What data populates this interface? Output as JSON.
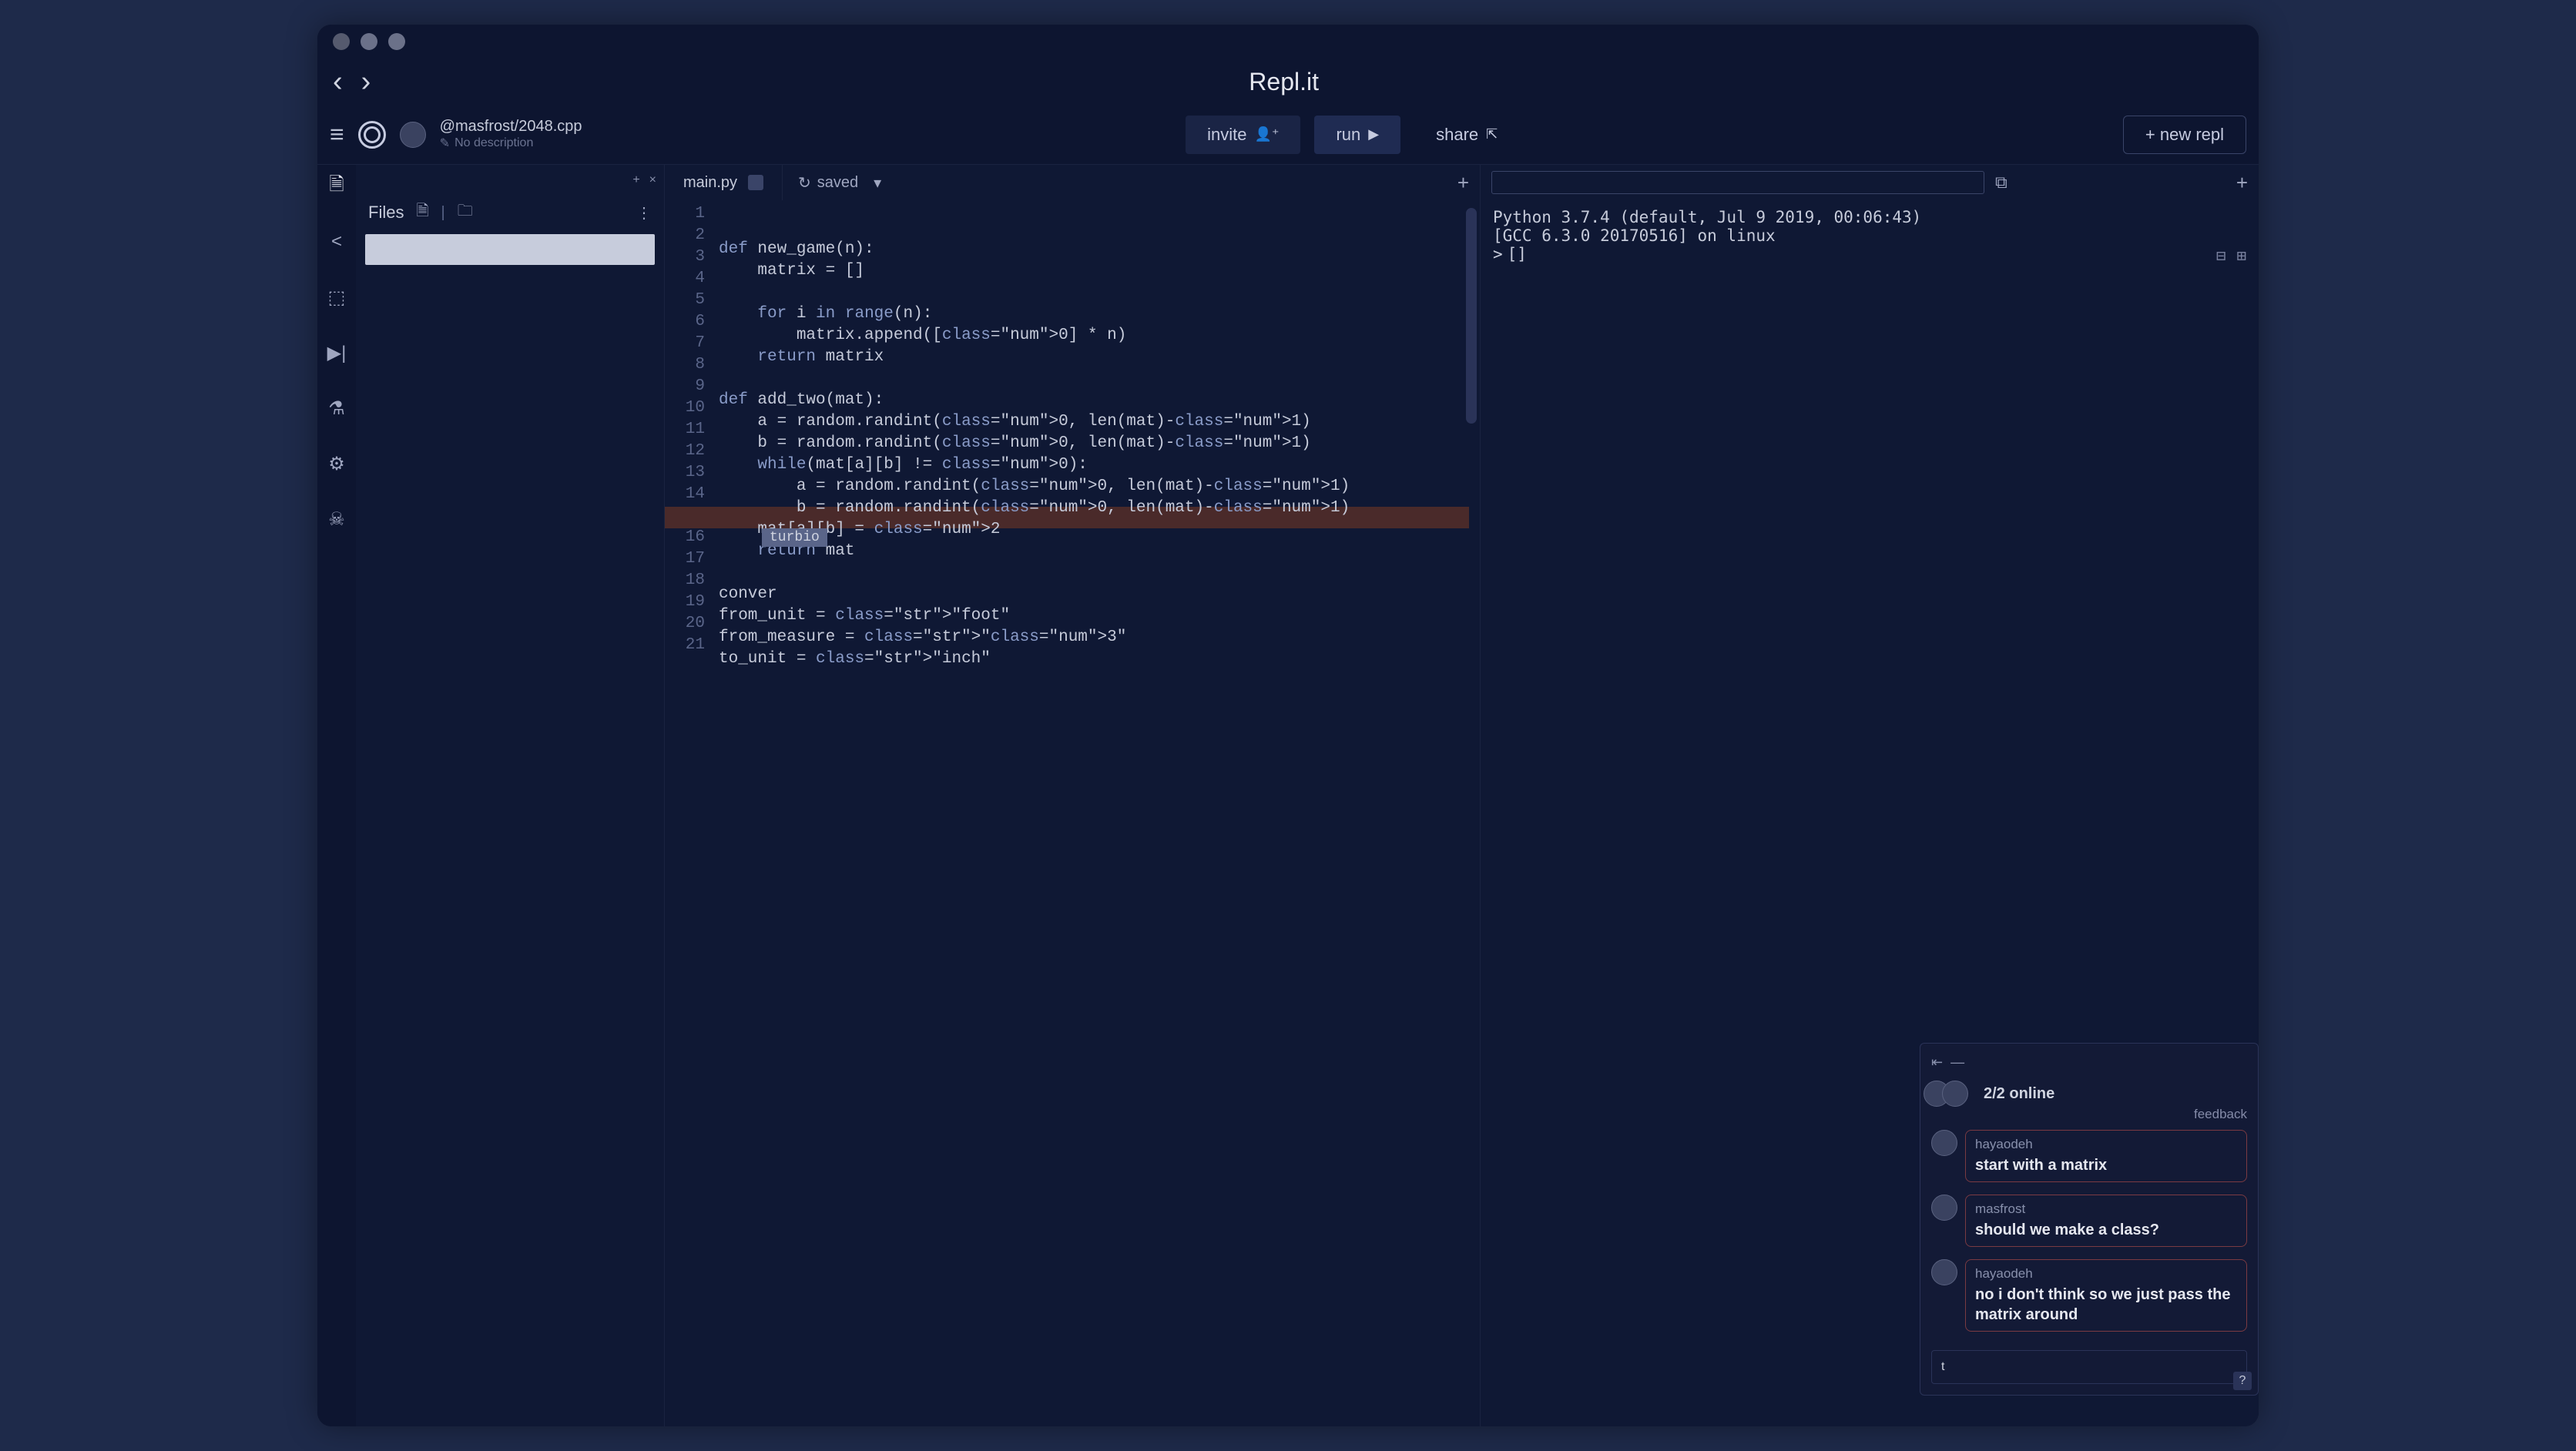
{
  "window": {
    "title": "Repl.it"
  },
  "repl": {
    "owner_path": "@masfrost/2048.cpp",
    "description": "No description"
  },
  "toolbar": {
    "invite": "invite",
    "run": "run",
    "share": "share",
    "new_repl": "+ new repl"
  },
  "files": {
    "header": "Files"
  },
  "editor": {
    "tab_name": "main.py",
    "saved_label": "saved",
    "suggestion": "turbio",
    "lines": [
      "def new_game(n):",
      "    matrix = []",
      "",
      "    for i in range(n):",
      "        matrix.append([0] * n)",
      "    return matrix",
      "",
      "def add_two(mat):",
      "    a = random.randint(0, len(mat)-1)",
      "    b = random.randint(0, len(mat)-1)",
      "    while(mat[a][b] != 0):",
      "        a = random.randint(0, len(mat)-1)",
      "        b = random.randint(0, len(mat)-1)",
      "    mat[a][b] = 2",
      "    return mat",
      "",
      "conver",
      "from_unit = \"foot\"",
      "from_measure = \"3\"",
      "to_unit = \"inch\"",
      ""
    ],
    "line_count": 21
  },
  "console": {
    "banner1": "Python 3.7.4 (default, Jul  9 2019, 00:06:43)",
    "banner2": "[GCC 6.3.0 20170516] on linux",
    "prompt": ">",
    "cursor": "[]"
  },
  "chat": {
    "online_text": "2/2 online",
    "feedback": "feedback",
    "input_value": "t",
    "messages": [
      {
        "user": "hayaodeh",
        "text": "start with a matrix"
      },
      {
        "user": "masfrost",
        "text": "should we make a class?"
      },
      {
        "user": "hayaodeh",
        "text": "no i don't think so we just pass the matrix around"
      }
    ],
    "help": "?"
  }
}
